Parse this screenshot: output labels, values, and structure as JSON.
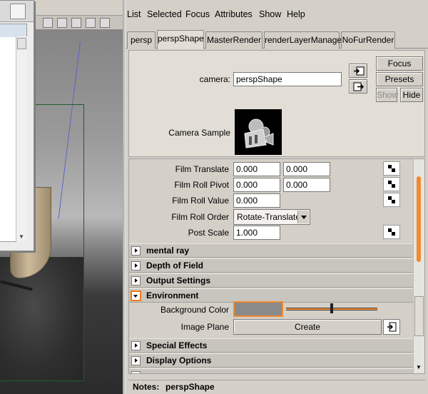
{
  "menu": [
    "List",
    "Selected",
    "Focus",
    "Attributes",
    "Show",
    "Help"
  ],
  "tabs": [
    "persp",
    "perspShape",
    "MasterRender",
    "renderLayerManager",
    "NoFurRender"
  ],
  "active_tab": "perspShape",
  "camera": {
    "label": "camera:",
    "value": "perspShape",
    "buttons": {
      "focus": "Focus",
      "presets": "Presets",
      "show": "Show",
      "hide": "Hide"
    },
    "sample_label": "Camera Sample"
  },
  "attributes": {
    "film_translate": {
      "label": "Film Translate",
      "x": "0.000",
      "y": "0.000"
    },
    "film_roll_pivot": {
      "label": "Film Roll Pivot",
      "x": "0.000",
      "y": "0.000"
    },
    "film_roll_value": {
      "label": "Film Roll Value",
      "value": "0.000"
    },
    "film_roll_order": {
      "label": "Film Roll Order",
      "value": "Rotate-Translate"
    },
    "post_scale": {
      "label": "Post Scale",
      "value": "1.000"
    }
  },
  "sections": {
    "mental_ray": "mental ray",
    "depth_of_field": "Depth of Field",
    "output_settings": "Output Settings",
    "environment": "Environment",
    "special_effects": "Special Effects",
    "display_options": "Display Options"
  },
  "environment": {
    "bg_label": "Background Color",
    "bg_color": "#8a8a8a",
    "image_plane_label": "Image Plane",
    "create": "Create"
  },
  "notes": {
    "label": "Notes:",
    "value": "perspShape"
  },
  "accent": "#f08a30"
}
